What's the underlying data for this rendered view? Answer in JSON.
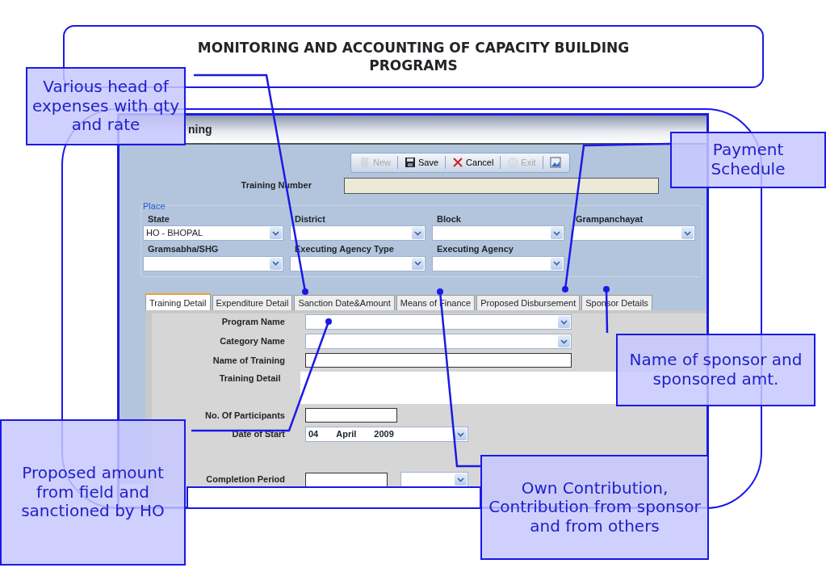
{
  "slide_title": "MONITORING AND ACCOUNTING OF CAPACITY BUILDING PROGRAMS",
  "app": {
    "title": "ning",
    "toolbar": [
      {
        "kind": "new",
        "label": "New",
        "disabled": true
      },
      {
        "kind": "save",
        "label": "Save",
        "disabled": false
      },
      {
        "kind": "cancel",
        "label": "Cancel",
        "disabled": false
      },
      {
        "kind": "exit",
        "label": "Exit",
        "disabled": true
      },
      {
        "kind": "image",
        "disabled": false
      }
    ],
    "training_number": {
      "label": "Training Number"
    },
    "place": {
      "legend": "Place",
      "fields": [
        {
          "label": "State",
          "value": "HO - BHOPAL"
        },
        {
          "label": "District"
        },
        {
          "label": "Block"
        },
        {
          "label": "Grampanchayat"
        },
        {
          "label": "Gramsabha/SHG"
        },
        {
          "label": "Executing Agency Type"
        },
        {
          "label": "Executing Agency"
        }
      ]
    },
    "tabs": [
      {
        "label": "Training Detail",
        "selected": true
      },
      {
        "label": "Expenditure Detail",
        "selected": false
      },
      {
        "label": "Sanction Date&Amount",
        "selected": false
      },
      {
        "label": "Means of Finance",
        "selected": false
      },
      {
        "label": "Proposed Disbursement",
        "selected": false
      },
      {
        "label": "Sponsor Details",
        "selected": false
      }
    ],
    "form": [
      {
        "kind": "select",
        "label": "Program Name"
      },
      {
        "kind": "select",
        "label": "Category Name"
      },
      {
        "kind": "text",
        "label": "Name of Training"
      },
      {
        "kind": "textarea",
        "label": "Training Detail"
      },
      {
        "kind": "short",
        "label": "No. Of Participants"
      },
      {
        "kind": "date",
        "label": "Date of Start",
        "day": "04",
        "month": "April",
        "year": "2009"
      },
      {
        "kind": "period",
        "label": "Completion Period"
      }
    ]
  },
  "callouts": [
    {
      "text": "Various head of expenses with qty and rate"
    },
    {
      "text": "Payment Schedule"
    },
    {
      "text": "Name of sponsor and sponsored amt."
    },
    {
      "text": "Proposed amount from field and sanctioned by HO"
    },
    {
      "text": "Own Contribution, Contribution from sponsor and from others"
    }
  ]
}
